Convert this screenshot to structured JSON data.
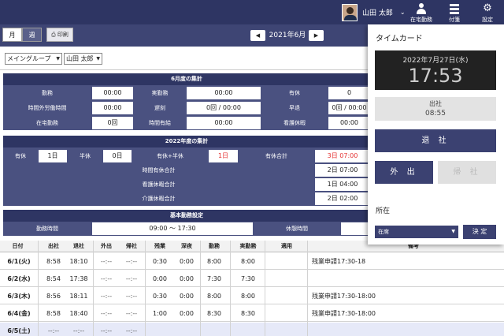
{
  "header": {
    "user_name": "山田 太郎",
    "remote_label": "在宅勤務",
    "sticky_label": "付箋",
    "settings_label": "設定"
  },
  "toolbar": {
    "month_label": "月",
    "week_label": "週",
    "print_label": "印刷",
    "current_month": "2021年6月"
  },
  "filters": {
    "group": "メイングループ",
    "user": "山田 太郎"
  },
  "monthly_summary": {
    "title": "6月度の集計",
    "rows": [
      [
        {
          "label": "勤務",
          "value": "00:00"
        },
        {
          "label": "実勤務",
          "value": "00:00"
        },
        {
          "label": "有休",
          "value": "0"
        }
      ],
      [
        {
          "label": "時間外労働時間",
          "value": "00:00"
        },
        {
          "label": "遅刻",
          "value": "0回 / 00:00"
        },
        {
          "label": "早退",
          "value": "0回 / 00:00"
        }
      ],
      [
        {
          "label": "在宅勤務",
          "value": "0回"
        },
        {
          "label": "時間有給",
          "value": "00:00"
        },
        {
          "label": "看護休暇",
          "value": "00:00"
        }
      ]
    ]
  },
  "yearly_summary": {
    "title": "2022年度の集計",
    "top": [
      {
        "label": "有休",
        "value": "1日"
      },
      {
        "label": "半休",
        "value": "0日"
      },
      {
        "label": "有休+半休",
        "value": "1日"
      },
      {
        "label": "有休合計",
        "value": "3日 07:00"
      }
    ],
    "rows": [
      {
        "label": "時間有休合計",
        "value": "2日 07:00"
      },
      {
        "label": "看護休暇合計",
        "value": "1日 04:00"
      },
      {
        "label": "介護休暇合計",
        "value": "2日 02:00"
      }
    ]
  },
  "basic_settings": {
    "title": "基本勤務設定",
    "work_time_label": "勤務時間",
    "work_time_value": "09:00 〜 17:30",
    "break_label": "休憩時間"
  },
  "time_table": {
    "columns": [
      "日付",
      "出社",
      "退社",
      "外出",
      "帰社",
      "残業",
      "深夜",
      "勤務",
      "実勤務",
      "適用",
      "備考"
    ],
    "rows": [
      {
        "date": "6/1(火)",
        "in": "8:58",
        "out": "18:10",
        "go": "--:--",
        "back": "--:--",
        "ot": "0:30",
        "night": "0:00",
        "work": "8:00",
        "actual": "8:00",
        "apply": "",
        "note": "残業申請17:30-18"
      },
      {
        "date": "6/2(水)",
        "in": "8:54",
        "out": "17:38",
        "go": "--:--",
        "back": "--:--",
        "ot": "0:00",
        "night": "0:00",
        "work": "7:30",
        "actual": "7:30",
        "apply": "",
        "note": ""
      },
      {
        "date": "6/3(木)",
        "in": "8:56",
        "out": "18:11",
        "go": "--:--",
        "back": "--:--",
        "ot": "0:30",
        "night": "0:00",
        "work": "8:00",
        "actual": "8:00",
        "apply": "",
        "note": "残業申請17:30-18:00"
      },
      {
        "date": "6/4(金)",
        "in": "8:58",
        "out": "18:40",
        "go": "--:--",
        "back": "--:--",
        "ot": "1:00",
        "night": "0:00",
        "work": "8:30",
        "actual": "8:30",
        "apply": "",
        "note": "残業申請17:30-18:00"
      },
      {
        "date": "6/5(土)",
        "in": "--:--",
        "out": "--:--",
        "go": "--:--",
        "back": "--:--",
        "ot": "",
        "night": "",
        "work": "",
        "actual": "",
        "apply": "",
        "note": ""
      }
    ]
  },
  "timecard": {
    "title": "タイムカード",
    "date": "2022年7月27日(水)",
    "time": "17:53",
    "status_label": "出社",
    "status_time": "08:55",
    "leave_button": "退 社",
    "out_button": "外 出",
    "return_button": "帰 社",
    "location_label": "所在",
    "location_value": "在席",
    "confirm_button": "決 定"
  },
  "colors": {
    "header_navy": "#2e3563",
    "label_navy": "#4a5180",
    "button_navy": "#3b4171",
    "alert_red": "#e53232"
  }
}
